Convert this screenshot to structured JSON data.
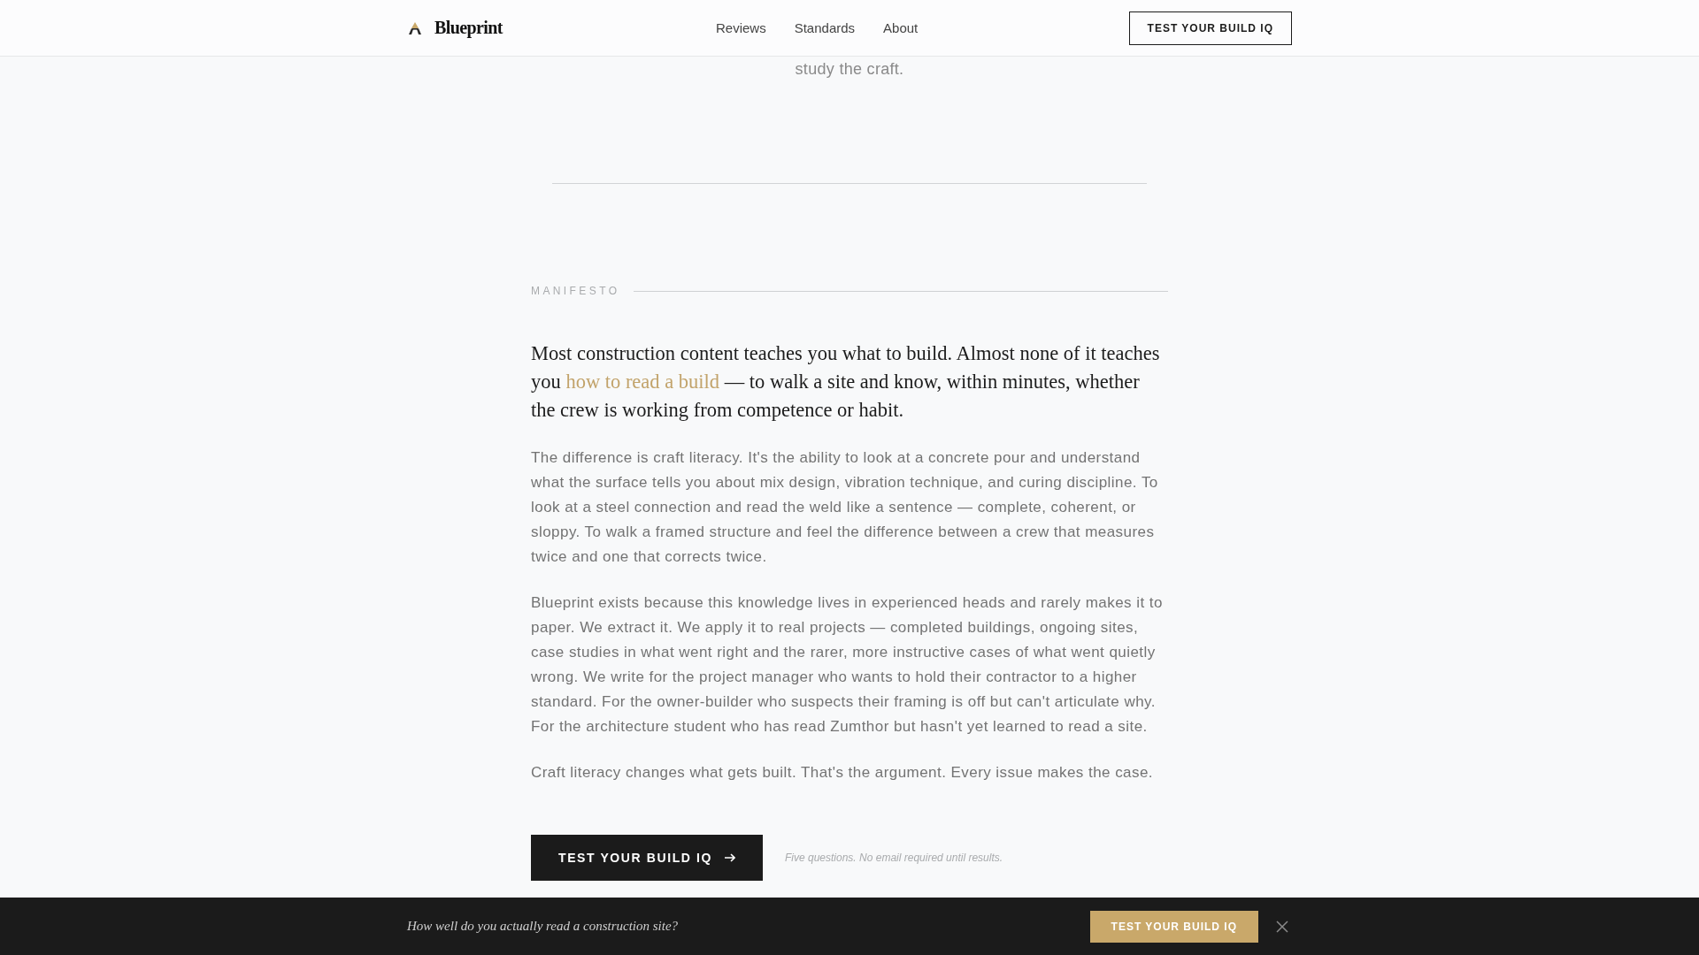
{
  "header": {
    "logo": "Blueprint",
    "nav": [
      {
        "label": "Reviews"
      },
      {
        "label": "Standards"
      },
      {
        "label": "About"
      }
    ],
    "cta": "TEST YOUR BUILD IQ"
  },
  "intro": {
    "text": "study the craft."
  },
  "manifesto": {
    "label": "MANIFESTO",
    "lead": {
      "before": "Most construction content teaches you what to build. Almost none of it teaches you",
      "link": "how to read a build",
      "after": "— to walk a site and know, within minutes, whether the crew is working from competence or habit."
    },
    "body": [
      "The difference is craft literacy. It's the ability to look at a concrete pour and understand what the surface tells you about mix design, vibration technique, and curing discipline. To look at a steel connection and read the weld like a sentence — complete, coherent, or sloppy. To walk a framed structure and feel the difference between a crew that measures twice and one that corrects twice.",
      "Blueprint exists because this knowledge lives in experienced heads and rarely makes it to paper. We extract it. We apply it to real projects — completed buildings, ongoing sites, case studies in what went right and the rarer, more instructive cases of what went quietly wrong. We write for the project manager who wants to hold their contractor to a higher standard. For the owner-builder who suspects their framing is off but can't articulate why. For the architecture student who has read Zumthor but hasn't yet learned to read a site.",
      "Craft literacy changes what gets built. That's the argument. Every issue makes the case."
    ],
    "cta": "TEST YOUR BUILD IQ",
    "note": "Five questions. No email required until results."
  },
  "banner": {
    "text": "How well do you actually read a construction site?",
    "button": "TEST YOUR BUILD IQ"
  }
}
